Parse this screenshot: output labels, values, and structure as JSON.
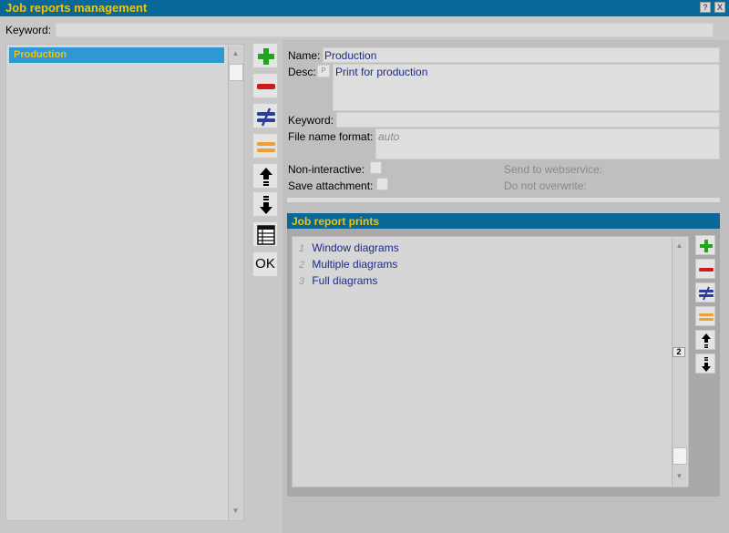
{
  "window": {
    "title": "Job reports management",
    "help_glyph": "?",
    "close_glyph": "X"
  },
  "top": {
    "keyword_label": "Keyword:",
    "keyword_value": ""
  },
  "list": {
    "items": [
      "Production"
    ]
  },
  "toolbar": {
    "icons": [
      "add-icon",
      "remove-icon",
      "modify-icon",
      "duplicate-icon",
      "move-up-icon",
      "move-down-icon",
      "table-icon"
    ],
    "ok_label": "OK"
  },
  "form": {
    "name_label": "Name:",
    "name_value": "Production",
    "desc_label": "Desc:",
    "desc_lang": "P",
    "desc_value": "Print for production",
    "keyword_label": "Keyword:",
    "keyword_value": "",
    "filename_label": "File name format:",
    "filename_placeholder": "auto",
    "noninteractive_label": "Non-interactive:",
    "save_attachment_label": "Save attachment:",
    "send_webservice_label": "Send to webservice:",
    "no_overwrite_label": "Do not overwrite:"
  },
  "prints": {
    "title": "Job report prints",
    "rows": [
      {
        "index": "1",
        "name": "Window diagrams"
      },
      {
        "index": "2",
        "name": "Multiple diagrams"
      },
      {
        "index": "3",
        "name": "Full diagrams"
      }
    ],
    "scroll_indicator": "2"
  },
  "colors": {
    "title_bar": "#0a6898",
    "title_text": "#f3c400",
    "selection": "#2e97d4",
    "value_text": "#1e2a8a",
    "add_green": "#1fa51f",
    "remove_red": "#cc1b1b",
    "modify_blue": "#2e3c9c",
    "duplicate_orange": "#f0a030"
  }
}
